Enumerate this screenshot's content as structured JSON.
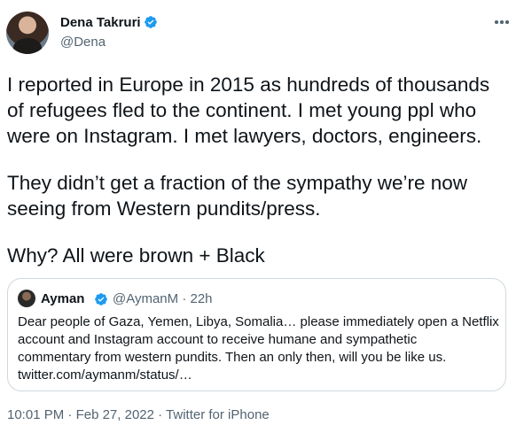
{
  "author": {
    "name": "Dena Takruri",
    "handle": "@Dena",
    "verified_color": "#1d9bf0"
  },
  "tweet": {
    "lines": [
      "I reported in Europe in 2015 as hundreds of thousands",
      "of refugees fled to the continent. I met young ppl who",
      "were on Instagram. I met lawyers, doctors, engineers.",
      "They didn’t get a fraction of the sympathy we’re now",
      "seeing from Western pundits/press.",
      "Why? All were brown + Black"
    ]
  },
  "quoted": {
    "name": "Ayman",
    "handle": "@AymanM",
    "separator": "·",
    "time": "22h",
    "lines": [
      "Dear people of Gaza, Yemen, Libya, Somalia… please immediately open a Netflix",
      "account and Instagram account to receive humane and sympathetic",
      "commentary from western pundits. Then an only then, will you be like us.",
      "twitter.com/aymanm/status/…"
    ]
  },
  "footer": {
    "time": "10:01 PM",
    "date": "Feb 27, 2022",
    "source": "Twitter for iPhone",
    "separator": "·"
  },
  "icons": {
    "more": "more-horizontal-icon",
    "verified": "verified-badge-icon"
  }
}
